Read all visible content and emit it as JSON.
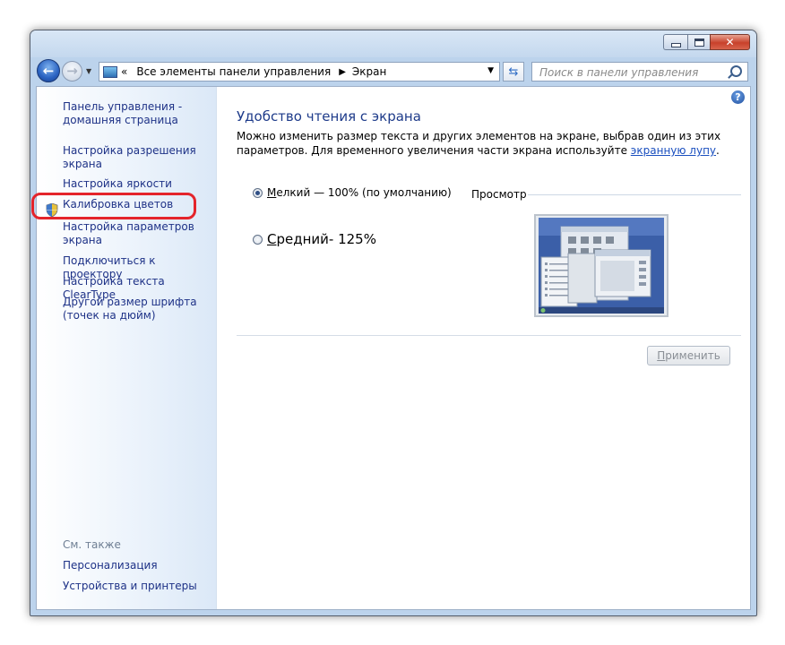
{
  "window": {
    "address": {
      "separator": "«",
      "crumbs": [
        "Все элементы панели управления",
        "Экран"
      ]
    },
    "search": {
      "placeholder": "Поиск в панели управления"
    }
  },
  "sidebar": {
    "links": [
      "Панель управления - домашняя страница",
      "Настройка разрешения экрана",
      "Настройка яркости",
      "Калибровка цветов",
      "Настройка параметров экрана",
      "Подключиться к проектору",
      "Настройка текста ClearType",
      "Другой размер шрифта (точек на дюйм)"
    ],
    "see_also": {
      "heading": "См. также",
      "links": [
        "Персонализация",
        "Устройства и принтеры"
      ]
    }
  },
  "main": {
    "title": "Удобство чтения с экрана",
    "description": "Можно изменить размер текста и других элементов на экране, выбрав один из этих параметров. Для временного увеличения части экрана используйте",
    "description_link": "экранную лупу",
    "description_end": ".",
    "options": [
      {
        "hotkey": "М",
        "label_rest": "елкий — 100% (по умолчанию)",
        "checked": true
      },
      {
        "hotkey": "С",
        "label_rest": "редний- 125%",
        "checked": false
      }
    ],
    "preview_label": "Просмотр",
    "apply_button": {
      "hotkey": "П",
      "label_rest": "рименить",
      "enabled": false
    }
  },
  "colors": {
    "link": "#1e3287",
    "title": "#1e3b8a",
    "highlight": "#e4242b"
  }
}
